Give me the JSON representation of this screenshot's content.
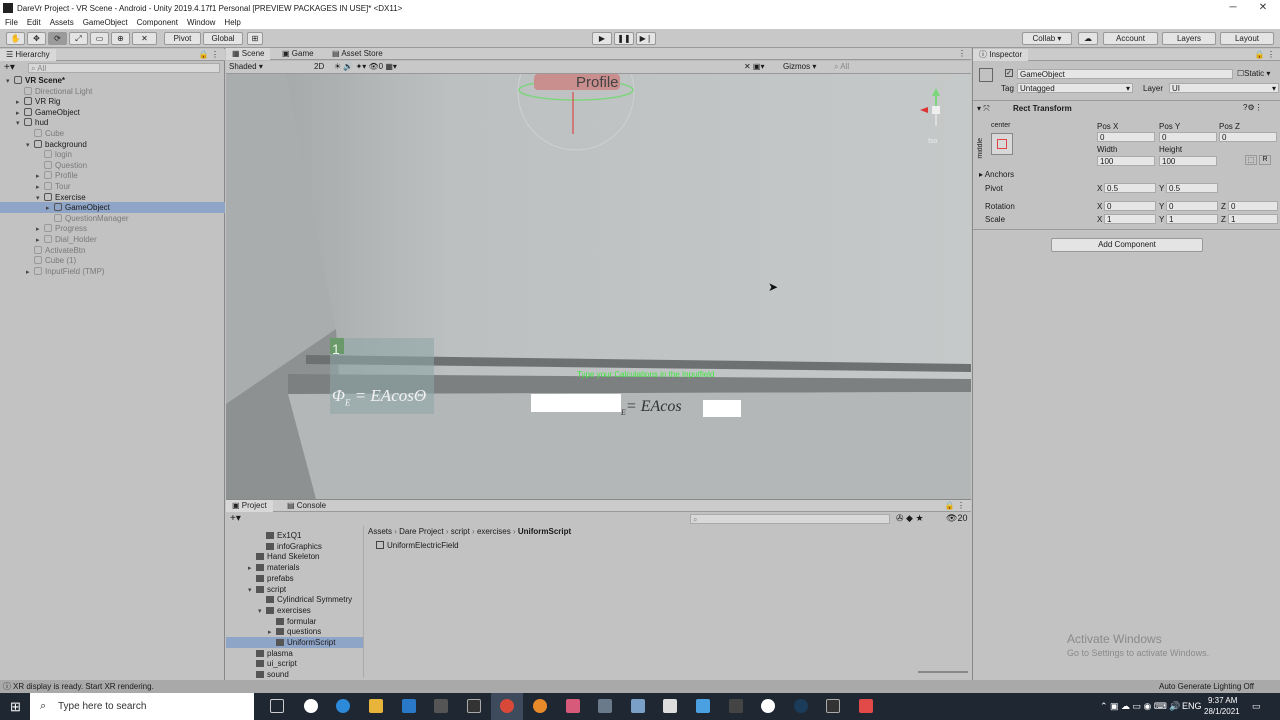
{
  "window": {
    "title": "DareVr Project - VR Scene - Android - Unity 2019.4.17f1 Personal [PREVIEW PACKAGES IN USE]* <DX11>",
    "controls": [
      "─",
      "❐",
      "✕"
    ]
  },
  "menu": [
    "File",
    "Edit",
    "Assets",
    "GameObject",
    "Component",
    "Window",
    "Help"
  ],
  "toolbar": {
    "pivot": "Pivot",
    "global": "Global",
    "collab": "Collab ▾",
    "account": "Account",
    "layers": "Layers",
    "layout": "Layout"
  },
  "hierarchy": {
    "tab": "Hierarchy",
    "search": "All",
    "rows": [
      {
        "label": "VR Scene*",
        "depth": 0,
        "expanded": true,
        "bold": true
      },
      {
        "label": "Directional Light",
        "depth": 1,
        "dim": true
      },
      {
        "label": "VR Rig",
        "depth": 1,
        "arrow": true
      },
      {
        "label": "GameObject",
        "depth": 1,
        "arrow": true
      },
      {
        "label": "hud",
        "depth": 1,
        "expanded": true
      },
      {
        "label": "Cube",
        "depth": 2,
        "dim": true
      },
      {
        "label": "background",
        "depth": 2,
        "expanded": true
      },
      {
        "label": "login",
        "depth": 3,
        "dim": true
      },
      {
        "label": "Question",
        "depth": 3,
        "dim": true
      },
      {
        "label": "Profile",
        "depth": 3,
        "dim": true,
        "arrow": true
      },
      {
        "label": "Tour",
        "depth": 3,
        "dim": true,
        "arrow": true
      },
      {
        "label": "Exercise",
        "depth": 3,
        "expanded": true
      },
      {
        "label": "GameObject",
        "depth": 4,
        "arrow": true,
        "selected": true
      },
      {
        "label": "QuestionManager",
        "depth": 4,
        "dim": true
      },
      {
        "label": "Progress",
        "depth": 3,
        "dim": true,
        "arrow": true
      },
      {
        "label": "Dial_Holder",
        "depth": 3,
        "dim": true,
        "arrow": true
      },
      {
        "label": "ActivateBtn",
        "depth": 2,
        "dim": true
      },
      {
        "label": "Cube (1)",
        "depth": 2,
        "dim": true
      },
      {
        "label": "InputField (TMP)",
        "depth": 2,
        "dim": true,
        "arrow": true
      }
    ]
  },
  "scene": {
    "tabs": [
      "Scene",
      "Game",
      "Asset Store"
    ],
    "shading": "Shaded",
    "mode2d": "2D",
    "gizmos": "Gizmos",
    "search": "All",
    "iso": "Iso",
    "profile_label": "Profile",
    "badge_number": "1",
    "formula_left": "Φ",
    "formula_left_sub": "E",
    "formula_left_rest": " = EAcosΘ",
    "prompt": "Type your Calculations in the Inputfield",
    "formula_right_sub": "E",
    "formula_right_rest": "= EAcos"
  },
  "project": {
    "tabs": [
      "Project",
      "Console"
    ],
    "tree": [
      {
        "label": "Ex1Q1",
        "depth": 1
      },
      {
        "label": "infoGraphics",
        "depth": 1
      },
      {
        "label": "Hand Skeleton",
        "depth": 0
      },
      {
        "label": "materials",
        "depth": 0,
        "arrow": true
      },
      {
        "label": "prefabs",
        "depth": 0
      },
      {
        "label": "script",
        "depth": 0,
        "expanded": true
      },
      {
        "label": "Cylindrical Symmetry",
        "depth": 1
      },
      {
        "label": "exercises",
        "depth": 1,
        "expanded": true
      },
      {
        "label": "formular",
        "depth": 2
      },
      {
        "label": "questions",
        "depth": 2,
        "arrow": true
      },
      {
        "label": "UniformScript",
        "depth": 2,
        "selected": true
      },
      {
        "label": "plasma",
        "depth": 0
      },
      {
        "label": "ui_script",
        "depth": 0
      },
      {
        "label": "sound",
        "depth": 0
      }
    ],
    "breadcrumb": [
      "Assets",
      "Dare Project",
      "script",
      "exercises",
      "UniformScript"
    ],
    "files": [
      "UniformElectricField"
    ],
    "count": "20"
  },
  "inspector": {
    "tab": "Inspector",
    "object_name": "GameObject",
    "static": "Static ▾",
    "tag_label": "Tag",
    "tag_value": "Untagged",
    "layer_label": "Layer",
    "layer_value": "UI",
    "component": "Rect Transform",
    "anchor_h": "center",
    "anchor_v": "middle",
    "posx_label": "Pos X",
    "posx": "0",
    "posy_label": "Pos Y",
    "posy": "0",
    "posz_label": "Pos Z",
    "posz": "0",
    "width_label": "Width",
    "width": "100",
    "height_label": "Height",
    "height": "100",
    "anchors_label": "Anchors",
    "pivot_label": "Pivot",
    "pivot_x": "0.5",
    "pivot_y": "0.5",
    "rotation_label": "Rotation",
    "rot_x": "0",
    "rot_y": "0",
    "rot_z": "0",
    "scale_label": "Scale",
    "scale_x": "1",
    "scale_y": "1",
    "scale_z": "1",
    "axis_x": "X",
    "axis_y": "Y",
    "axis_z": "Z",
    "r_button": "R",
    "add_component": "Add Component",
    "watermark_title": "Activate Windows",
    "watermark_sub": "Go to Settings to activate Windows."
  },
  "status": {
    "message": "XR display is ready. Start XR rendering.",
    "lighting": "Auto Generate Lighting Off"
  },
  "taskbar": {
    "search_placeholder": "Type here to search",
    "lang": "ENG",
    "time": "9:37 AM",
    "date": "28/1/2021"
  }
}
